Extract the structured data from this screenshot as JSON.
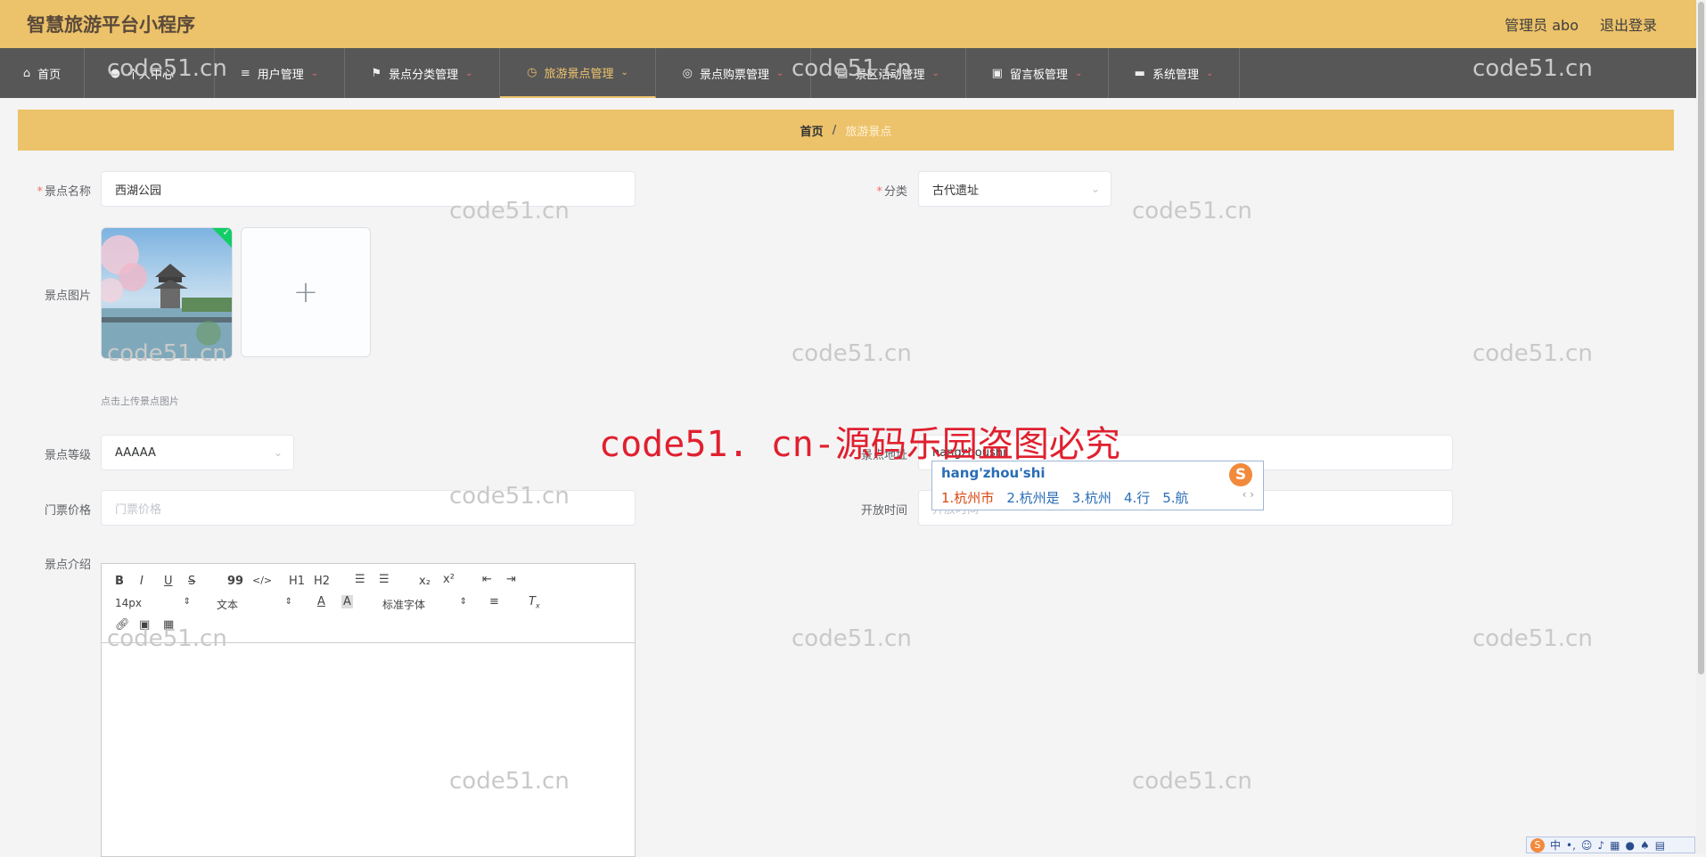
{
  "header": {
    "title": "智慧旅游平台小程序",
    "user_label": "管理员 abo",
    "logout_label": "退出登录",
    "bg_color": "#ecc26a"
  },
  "nav": {
    "items": [
      {
        "label": "首页",
        "icon": "home-icon"
      },
      {
        "label": "个人中心",
        "icon": "user-icon"
      },
      {
        "label": "用户管理",
        "icon": "list-icon"
      },
      {
        "label": "景点分类管理",
        "icon": "flag-icon"
      },
      {
        "label": "旅游景点管理",
        "icon": "clock-icon",
        "active": true
      },
      {
        "label": "景点购票管理",
        "icon": "compass-icon"
      },
      {
        "label": "景区活动管理",
        "icon": "document-icon"
      },
      {
        "label": "留言板管理",
        "icon": "briefcase-icon"
      },
      {
        "label": "系统管理",
        "icon": "monitor-icon"
      }
    ],
    "active_color": "#f0c46c"
  },
  "breadcrumb": {
    "home": "首页",
    "separator": "/",
    "current": "旅游景点"
  },
  "form": {
    "name_label": "景点名称",
    "name_value": "西湖公园",
    "category_label": "分类",
    "category_value": "古代遗址",
    "image_label": "景点图片",
    "upload_tip": "点击上传景点图片",
    "upload_plus": "+",
    "level_label": "景点等级",
    "level_value": "AAAAA",
    "address_label": "景点地址",
    "address_value": "hangzhoushi",
    "price_label": "门票价格",
    "price_placeholder": "门票价格",
    "open_time_label": "开放时间",
    "open_time_placeholder": "开放时间",
    "intro_label": "景点介绍",
    "required_mark": "*"
  },
  "editor": {
    "toolbar": {
      "bold": "B",
      "italic": "I",
      "underline": "U",
      "strike": "S",
      "quote": "99",
      "code": "</>",
      "h1": "H1",
      "h2": "H2",
      "sub": "x₂",
      "sup": "x²",
      "size_value": "14px",
      "header_value": "文本",
      "font_value": "标准字体"
    }
  },
  "ime": {
    "composition": "hang'zhou'shi",
    "candidates": [
      "1.杭州市",
      "2.杭州是",
      "3.杭州",
      "4.行",
      "5.航"
    ],
    "logo": "S",
    "nav": "‹ ›"
  },
  "tray": {
    "logo": "S",
    "mode": "中"
  },
  "watermark": {
    "text": "code51.cn",
    "banner": "code51. cn-源码乐园盗图必究"
  }
}
